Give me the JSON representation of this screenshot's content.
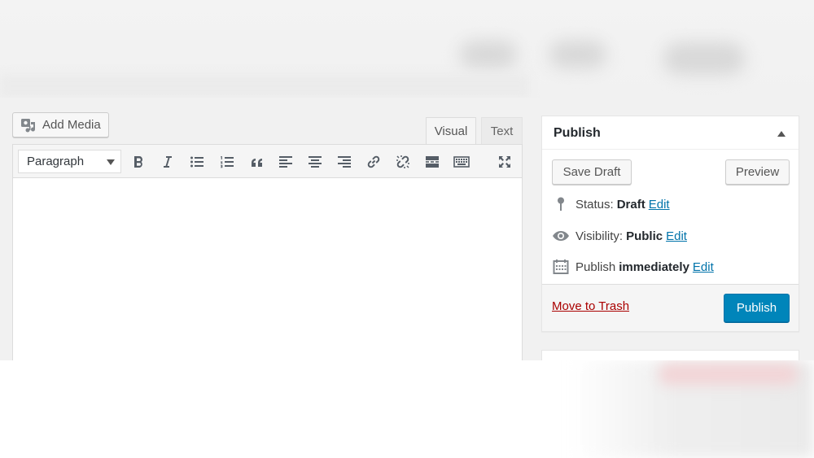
{
  "toolbar": {
    "add_media_label": "Add Media",
    "tabs": {
      "visual": "Visual",
      "text": "Text"
    },
    "format_value": "Paragraph",
    "buttons": [
      "bold-icon",
      "italic-icon",
      "bulleted-list-icon",
      "numbered-list-icon",
      "blockquote-icon",
      "align-left-icon",
      "align-center-icon",
      "align-right-icon",
      "link-icon",
      "unlink-icon",
      "read-more-icon",
      "toolbar-toggle-icon",
      "fullscreen-icon"
    ]
  },
  "publish_box": {
    "title": "Publish",
    "save_draft": "Save Draft",
    "preview": "Preview",
    "status_label": "Status:",
    "status_value": "Draft",
    "status_edit": "Edit",
    "visibility_label": "Visibility:",
    "visibility_value": "Public",
    "visibility_edit": "Edit",
    "schedule_label": "Publish",
    "schedule_value": "immediately",
    "schedule_edit": "Edit",
    "trash": "Move to Trash",
    "publish_button": "Publish"
  },
  "colors": {
    "admin_bg": "#f1f1f1",
    "primary": "#0085ba",
    "link": "#0073aa",
    "trash": "#aa0000"
  }
}
